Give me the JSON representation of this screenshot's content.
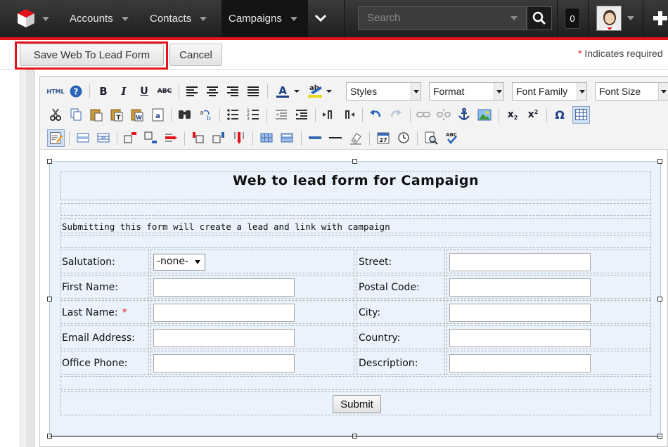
{
  "nav": {
    "items": [
      {
        "label": "Accounts"
      },
      {
        "label": "Contacts"
      },
      {
        "label": "Campaigns",
        "active": true
      }
    ],
    "search_placeholder": "Search",
    "notification_count": "0"
  },
  "actions": {
    "save_label": "Save Web To Lead Form",
    "cancel_label": "Cancel",
    "required_star": "*",
    "required_note": "Indicates required"
  },
  "toolbar": {
    "styles_label": "Styles",
    "format_label": "Format",
    "font_family_label": "Font Family",
    "font_size_label": "Font Size"
  },
  "form": {
    "title": "Web to lead form for Campaign",
    "subtitle": "Submitting this form will create a lead and link with campaign",
    "left_fields": [
      {
        "label": "Salutation:"
      },
      {
        "label": "First Name:"
      },
      {
        "label": "Last Name:",
        "required": "*"
      },
      {
        "label": "Email Address:"
      },
      {
        "label": "Office Phone:"
      }
    ],
    "right_fields": [
      {
        "label": "Street:"
      },
      {
        "label": "Postal Code:"
      },
      {
        "label": "City:"
      },
      {
        "label": "Country:"
      },
      {
        "label": "Description:"
      }
    ],
    "salutation_value": "-none-",
    "submit_label": "Submit"
  },
  "colors": {
    "accent": "#e3121b",
    "nav_bg": "#2b2b2b",
    "form_bg": "#eaf2fc"
  }
}
